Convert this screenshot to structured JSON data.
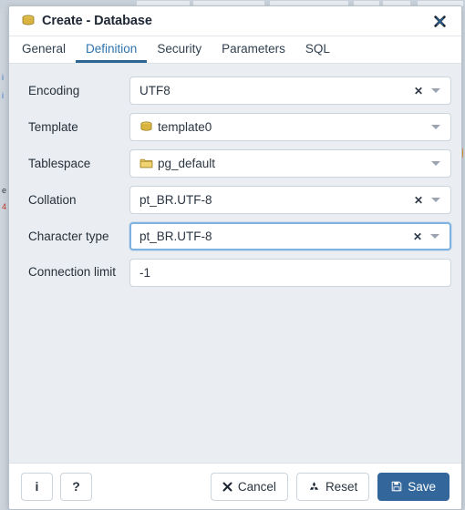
{
  "window": {
    "title": "Create - Database",
    "title_icon": "database-icon",
    "close_icon": "close-icon",
    "close_label": "✖"
  },
  "tabs": {
    "active": "Definition",
    "items": [
      {
        "label": "General",
        "name": "tab-general"
      },
      {
        "label": "Definition",
        "name": "tab-definition"
      },
      {
        "label": "Security",
        "name": "tab-security"
      },
      {
        "label": "Parameters",
        "name": "tab-parameters"
      },
      {
        "label": "SQL",
        "name": "tab-sql"
      }
    ]
  },
  "form": {
    "fields": [
      {
        "label": "Encoding",
        "value": "UTF8",
        "type": "select",
        "icon": null,
        "clearable": true,
        "focused": false
      },
      {
        "label": "Template",
        "value": "template0",
        "type": "select",
        "icon": "database-icon",
        "clearable": false,
        "focused": false
      },
      {
        "label": "Tablespace",
        "value": "pg_default",
        "type": "select",
        "icon": "folder-icon",
        "clearable": false,
        "focused": false
      },
      {
        "label": "Collation",
        "value": "pt_BR.UTF-8",
        "type": "select",
        "icon": null,
        "clearable": true,
        "focused": false
      },
      {
        "label": "Character type",
        "value": "pt_BR.UTF-8",
        "type": "select",
        "icon": null,
        "clearable": true,
        "focused": true
      },
      {
        "label": "Connection limit",
        "value": "-1",
        "type": "text",
        "icon": null,
        "clearable": false,
        "focused": false
      }
    ],
    "clear_glyph": "✕",
    "dropdown_icon": "chevron-down-icon"
  },
  "footer": {
    "info_label": "i",
    "info_icon": "info-icon",
    "help_label": "?",
    "help_icon": "help-icon",
    "cancel_label": "Cancel",
    "cancel_icon": "close-x-icon",
    "cancel_glyph": "✖",
    "reset_label": "Reset",
    "reset_icon": "recycle-icon",
    "reset_glyph": "♻",
    "save_label": "Save",
    "save_icon": "floppy-disk-icon",
    "save_glyph": "💾"
  },
  "colors": {
    "accent": "#2c6591",
    "primary_button": "#33679b",
    "body_background": "#eaeef2",
    "focus_border": "#7fb2e0",
    "icon_gold": "#d9b441"
  }
}
